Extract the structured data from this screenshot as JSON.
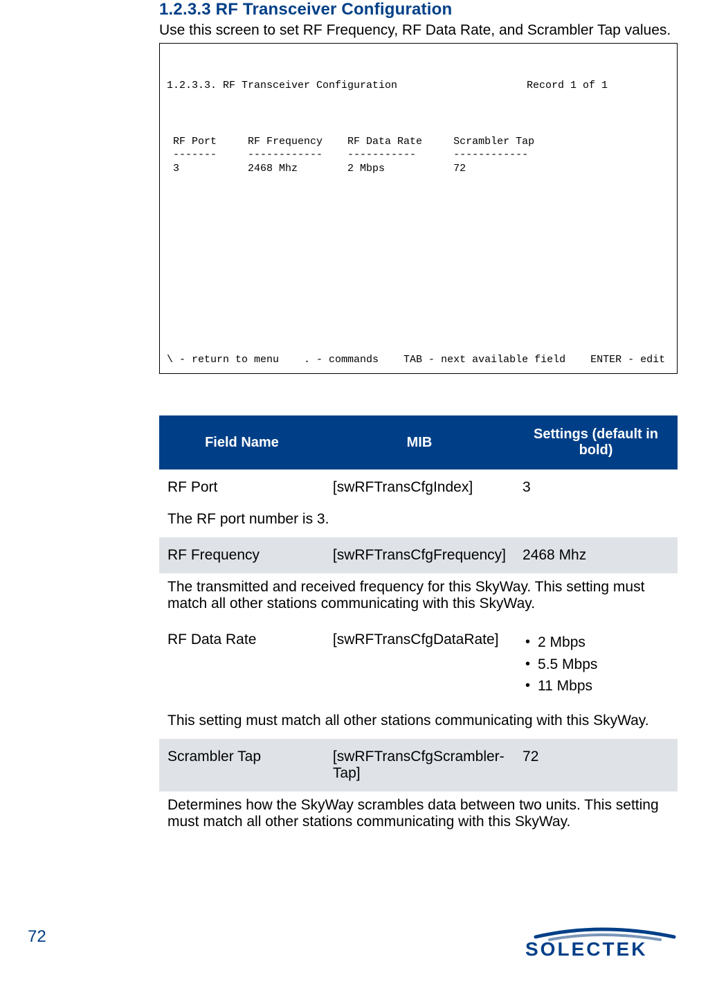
{
  "section": {
    "heading": "1.2.3.3 RF Transceiver Configuration",
    "intro": "Use this screen to set RF Frequency, RF Data Rate, and Scrambler Tap values."
  },
  "terminal": {
    "title": "1.2.3.3. RF Transceiver Configuration",
    "record": "Record 1 of 1",
    "columns": " RF Port     RF Frequency    RF Data Rate     Scrambler Tap\n -------     ------------    -----------      ------------\n 3           2468 Mhz        2 Mbps           72",
    "footer": "\\ - return to menu    . - commands    TAB - next available field    ENTER - edit"
  },
  "table": {
    "headers": {
      "field": "Field Name",
      "mib": "MIB",
      "settings": "Settings (default in bold)"
    },
    "rows": [
      {
        "field": "RF Port",
        "mib": "[swRFTransCfgIndex]",
        "settings": "3",
        "desc": "The RF port number is 3."
      },
      {
        "field": "RF Frequency",
        "mib": "[swRFTransCfgFrequency]",
        "settings": "2468 Mhz",
        "desc": "The transmitted and received frequency for this SkyWay. This setting must match all other stations communicating with this SkyWay."
      },
      {
        "field": "RF Data Rate",
        "mib": "[swRFTransCfgDataRate]",
        "settings_list": [
          "2 Mbps",
          "5.5 Mbps",
          "11 Mbps"
        ],
        "desc": "This setting must match all other stations communicating with this SkyWay."
      },
      {
        "field": "Scrambler Tap",
        "mib": "[swRFTransCfgScrambler-Tap]",
        "settings": "72",
        "desc": "Determines how the SkyWay scrambles data between two units. This setting must match all other stations communicating with this SkyWay."
      }
    ]
  },
  "page": {
    "number": "72"
  },
  "logo": {
    "text": "SOLECTEK"
  }
}
